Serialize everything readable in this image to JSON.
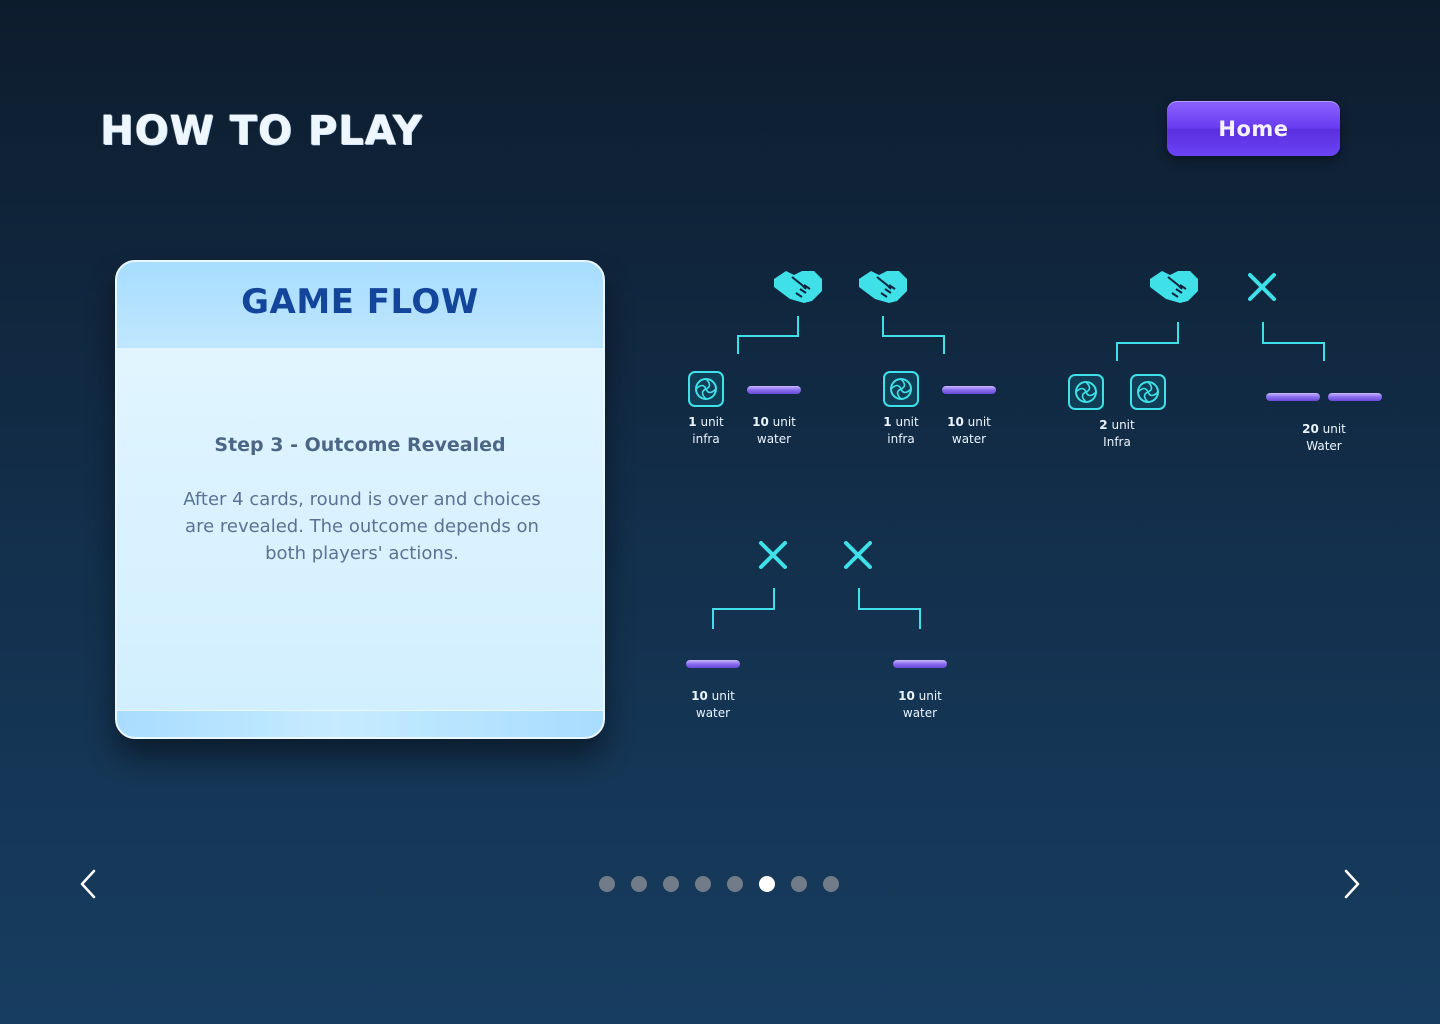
{
  "header": {
    "title": "HOW TO PLAY",
    "home_label": "Home"
  },
  "card": {
    "title": "GAME FLOW",
    "step_title": "Step 3 - Outcome Revealed",
    "description": "After 4 cards, round is over and choices are revealed. The outcome depends on both players' actions."
  },
  "outcomes": [
    {
      "choices": [
        "handshake-icon",
        "handshake-icon"
      ],
      "results": [
        {
          "amount": "1",
          "unit_text": "unit",
          "resource": "infra",
          "icon": "infra-icon"
        },
        {
          "amount": "10",
          "unit_text": "unit",
          "resource": "water",
          "icon": "water-bar"
        },
        {
          "amount": "1",
          "unit_text": "unit",
          "resource": "infra",
          "icon": "infra-icon"
        },
        {
          "amount": "10",
          "unit_text": "unit",
          "resource": "water",
          "icon": "water-bar"
        }
      ]
    },
    {
      "choices": [
        "handshake-icon",
        "cross-icon"
      ],
      "results": [
        {
          "amount": "2",
          "unit_text": "unit",
          "resource": "Infra",
          "icon": "infra-icon"
        },
        {
          "amount": "20",
          "unit_text": "unit",
          "resource": "Water",
          "icon": "water-bar"
        }
      ]
    },
    {
      "choices": [
        "cross-icon",
        "cross-icon"
      ],
      "results": [
        {
          "amount": "10",
          "unit_text": "unit",
          "resource": "water",
          "icon": "water-bar"
        },
        {
          "amount": "10",
          "unit_text": "unit",
          "resource": "water",
          "icon": "water-bar"
        }
      ]
    }
  ],
  "pagination": {
    "total": 8,
    "active_index": 5
  },
  "colors": {
    "accent_cyan": "#3fe0e8",
    "water_purple": "#8a6cf0",
    "button_purple": "#6a3cf2",
    "card_title": "#13469a"
  }
}
